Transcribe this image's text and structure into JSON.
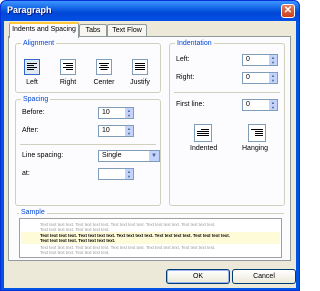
{
  "title": "Paragraph",
  "close_glyph": "✕",
  "tabs": [
    {
      "label": "Indents and Spacing",
      "active": true
    },
    {
      "label": "Tabs",
      "active": false
    },
    {
      "label": "Text Flow",
      "active": false
    }
  ],
  "alignment": {
    "title": "Alignment",
    "options": [
      "Left",
      "Right",
      "Center",
      "Justify"
    ],
    "selected": "Left"
  },
  "indentation": {
    "title": "Indentation",
    "left_label": "Left:",
    "left_value": "0",
    "right_label": "Right:",
    "right_value": "0",
    "first_line_label": "First line:",
    "first_line_value": "0",
    "indented_label": "Indented",
    "hanging_label": "Hanging"
  },
  "spacing": {
    "title": "Spacing",
    "before_label": "Before:",
    "before_value": "10",
    "after_label": "After:",
    "after_value": "10",
    "line_spacing_label": "Line spacing:",
    "line_spacing_value": "Single",
    "at_label": "at:",
    "at_value": ""
  },
  "sample": {
    "title": "Sample",
    "prev_line1": "Text text text text. Text text text text. Text text text text. Text text text text. Text text text text.",
    "prev_line2": "Text text text text. Text text text text.",
    "cur_line1": "Text text text text. Text text text text. Text text text text. Text text text text. Text text text text.",
    "cur_line2": "Text text text text. Text text text text.",
    "next_line1": "Text text text text. Text text text text. Text text text text. Text text text text. Text text text text.",
    "next_line2": "Text text text text. Text text text text."
  },
  "buttons": {
    "ok": "OK",
    "cancel": "Cancel"
  }
}
